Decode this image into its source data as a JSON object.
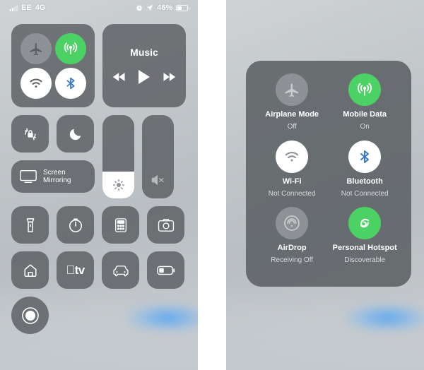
{
  "status_bar": {
    "carrier": "EE",
    "network": "4G",
    "battery_percent": "46%",
    "icons": [
      "signal-bars-icon",
      "alarm-icon",
      "location-arrow-icon",
      "battery-icon"
    ]
  },
  "left_panel": {
    "connectivity": {
      "airplane": {
        "name": "airplane-mode-toggle",
        "state": "off",
        "style": "grey"
      },
      "mobile_data": {
        "name": "mobile-data-toggle",
        "state": "on",
        "style": "green"
      },
      "wifi": {
        "name": "wifi-toggle",
        "state": "off",
        "style": "white"
      },
      "bluetooth": {
        "name": "bluetooth-toggle",
        "state": "off",
        "style": "white"
      }
    },
    "music": {
      "title": "Music",
      "prev_label": "Previous",
      "play_label": "Play",
      "next_label": "Next"
    },
    "rotation_lock_label": "Rotation Lock",
    "do_not_disturb_label": "Do Not Disturb",
    "screen_mirroring_label": "Screen\nMirroring",
    "screen_mirroring_line1": "Screen",
    "screen_mirroring_line2": "Mirroring",
    "brightness": {
      "name": "brightness-slider",
      "value_percent": 32
    },
    "volume": {
      "name": "volume-slider",
      "value_percent": 0,
      "muted": true
    },
    "shortcuts": [
      {
        "name": "flashlight-button",
        "label": "Flashlight"
      },
      {
        "name": "timer-button",
        "label": "Timer"
      },
      {
        "name": "calculator-button",
        "label": "Calculator"
      },
      {
        "name": "camera-button",
        "label": "Camera"
      },
      {
        "name": "home-button",
        "label": "Home"
      },
      {
        "name": "apple-tv-remote-button",
        "label": "Apple TV Remote"
      },
      {
        "name": "car-button",
        "label": "Car Mode"
      },
      {
        "name": "low-power-button",
        "label": "Low Power Mode"
      },
      {
        "name": "screen-record-button",
        "label": "Screen Recording"
      }
    ]
  },
  "right_panel": {
    "tiles": [
      {
        "name": "airplane-mode-tile",
        "icon": "airplane-icon",
        "label": "Airplane Mode",
        "sub": "Off",
        "style": "grey"
      },
      {
        "name": "mobile-data-tile",
        "icon": "mobile-data-icon",
        "label": "Mobile Data",
        "sub": "On",
        "style": "green"
      },
      {
        "name": "wifi-tile",
        "icon": "wifi-icon",
        "label": "Wi-Fi",
        "sub": "Not Connected",
        "style": "white"
      },
      {
        "name": "bluetooth-tile",
        "icon": "bluetooth-icon",
        "label": "Bluetooth",
        "sub": "Not Connected",
        "style": "white"
      },
      {
        "name": "airdrop-tile",
        "icon": "airdrop-icon",
        "label": "AirDrop",
        "sub": "Receiving Off",
        "style": "grey"
      },
      {
        "name": "personal-hotspot-tile",
        "icon": "personal-hotspot-icon",
        "label": "Personal Hotspot",
        "sub": "Discoverable",
        "style": "green"
      }
    ]
  },
  "colors": {
    "green": "#4cd264",
    "grey_circle": "#8e9296",
    "module_bg": "rgba(90,94,98,.82)",
    "white": "#ffffff"
  }
}
